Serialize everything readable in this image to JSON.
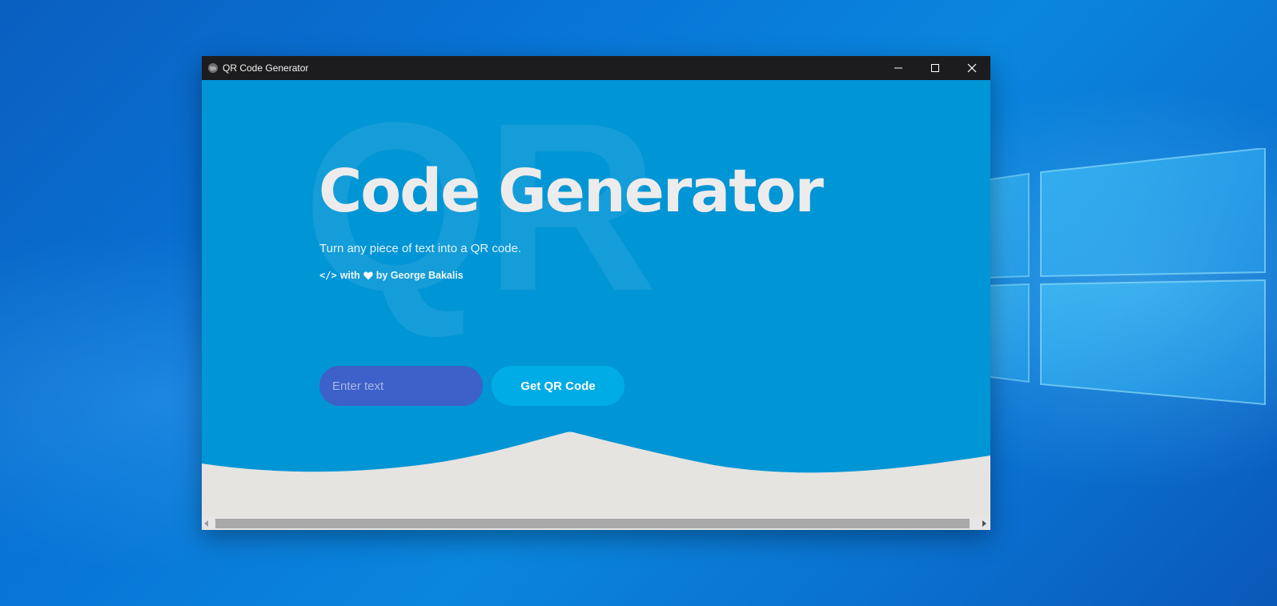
{
  "window": {
    "title": "QR Code Generator",
    "app_icon": "globe-icon",
    "controls": [
      "minimize-icon",
      "maximize-icon",
      "close-icon"
    ]
  },
  "hero": {
    "background_text": "QR",
    "title": "Code Generator",
    "subtitle": "Turn any piece of text into a QR code.",
    "credit_with": "with",
    "credit_by": "by George Bakalis"
  },
  "form": {
    "input_placeholder": "Enter text",
    "input_value": "",
    "button_label": "Get QR Code"
  },
  "colors": {
    "page_background": "#0095d5",
    "input_background": "#3d60c9",
    "button_background": "#00ace6",
    "footer_wave": "#e5e4e1",
    "titlebar": "#1c1c1e"
  }
}
